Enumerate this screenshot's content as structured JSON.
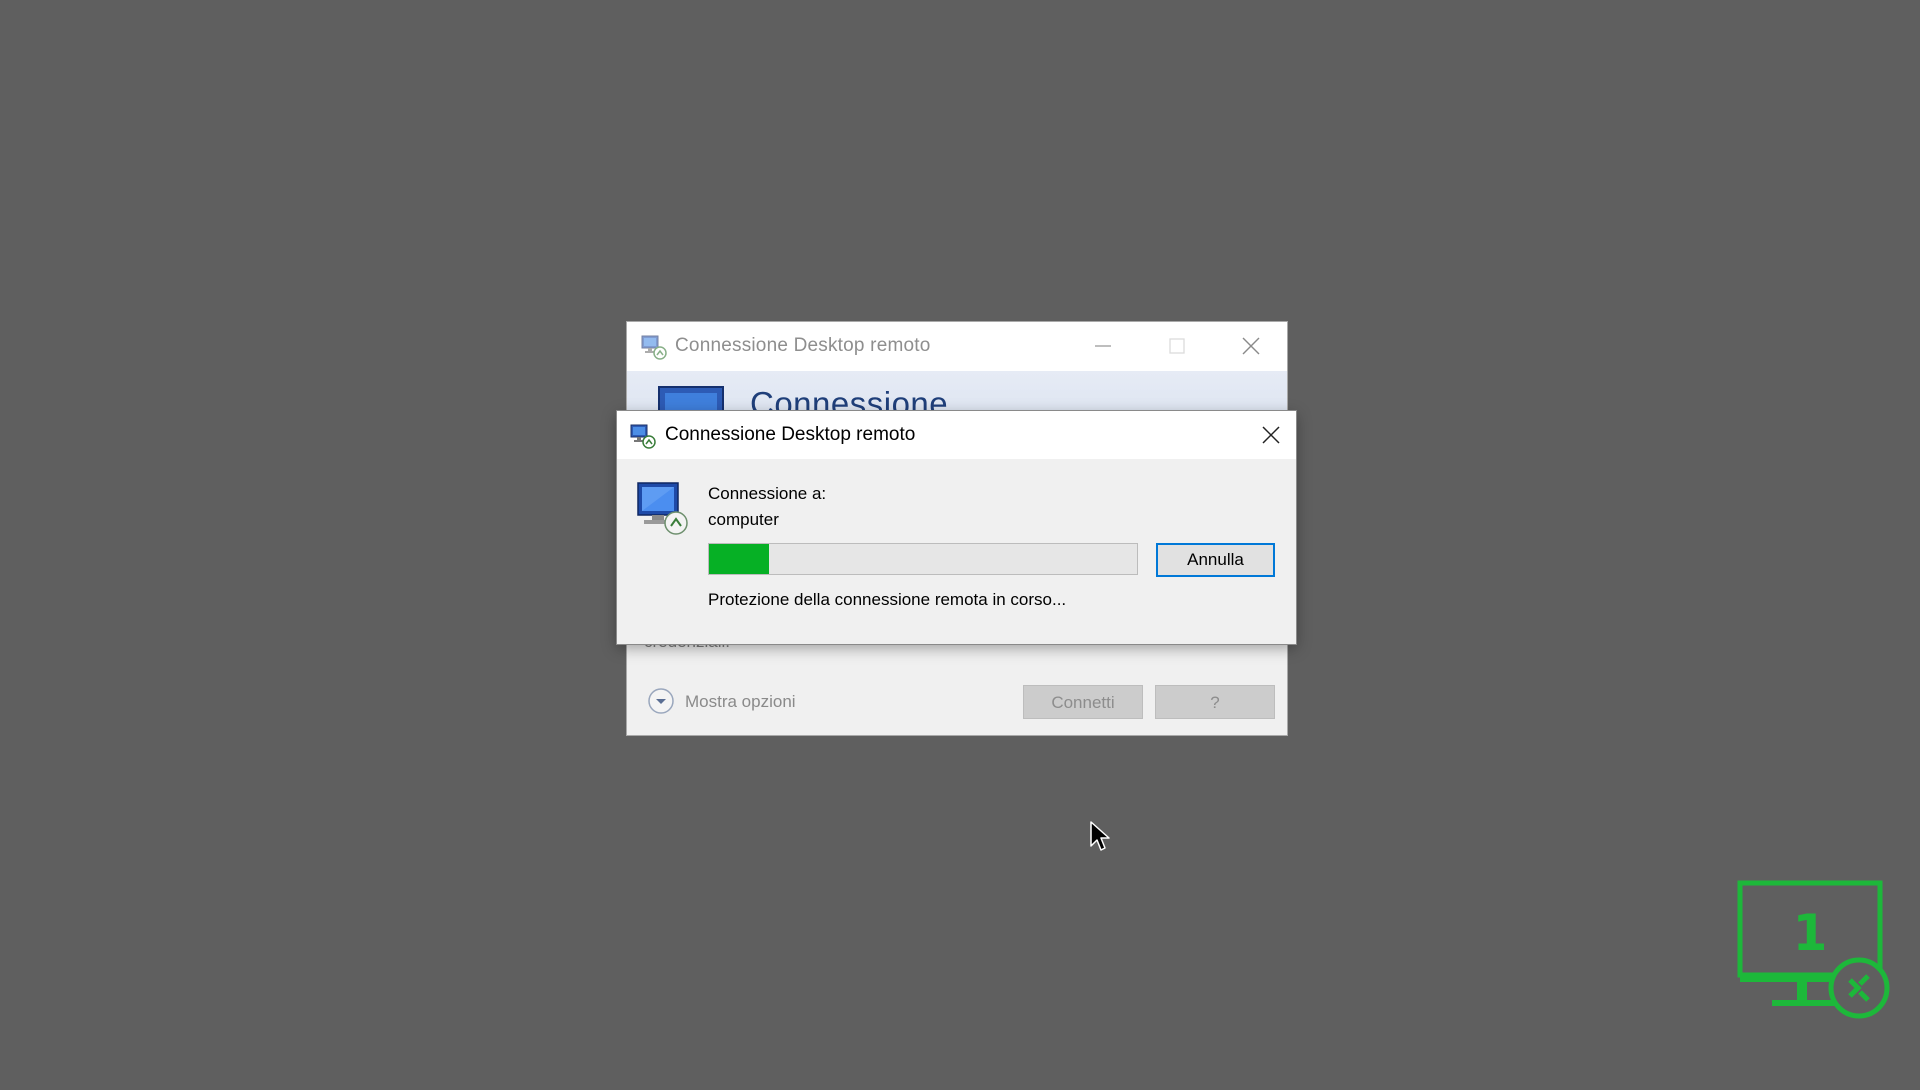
{
  "background_window": {
    "title": "Connessione Desktop remoto",
    "banner_title": "Connessione",
    "hidden_text": "credenziali.",
    "show_options_label": "Mostra opzioni",
    "connect_label": "Connetti",
    "help_label": "?"
  },
  "dialog": {
    "title": "Connessione Desktop remoto",
    "connecting_label": "Connessione a:",
    "computer_name": "computer",
    "progress_percent": 14,
    "cancel_label": "Annulla",
    "status_text": "Protezione della connessione remota in corso..."
  },
  "watermark": {
    "number": "1"
  },
  "colors": {
    "desktop": "#5f5f5f",
    "progress": "#06b025",
    "focus_border": "#0078d7",
    "watermark": "#1db83a"
  }
}
